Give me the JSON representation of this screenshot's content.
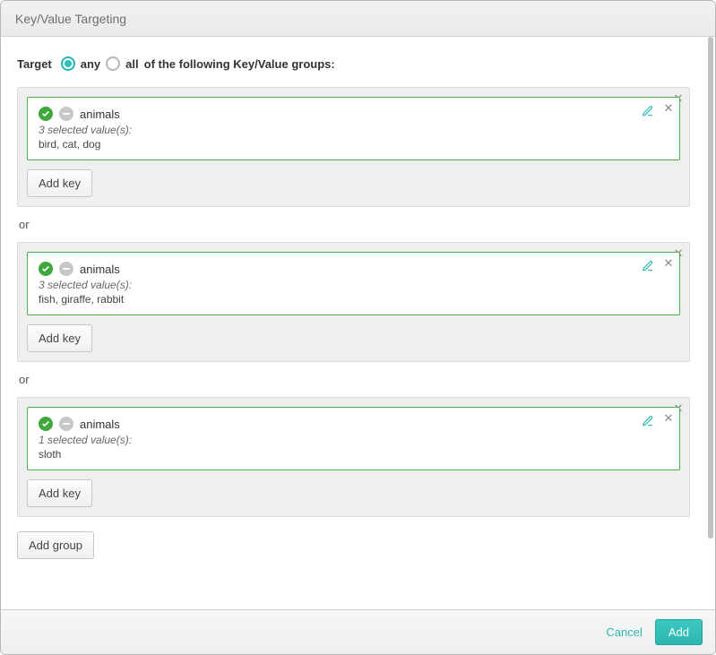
{
  "header": {
    "title": "Key/Value Targeting"
  },
  "target": {
    "label": "Target",
    "any": "any",
    "all": "all",
    "tail": "of the following Key/Value groups:",
    "selected": "any"
  },
  "separator": "or",
  "groups": [
    {
      "key_name": "animals",
      "selected_text": "3 selected value(s):",
      "values": "bird, cat, dog",
      "add_key_label": "Add key"
    },
    {
      "key_name": "animals",
      "selected_text": "3 selected value(s):",
      "values": "fish, giraffe, rabbit",
      "add_key_label": "Add key"
    },
    {
      "key_name": "animals",
      "selected_text": "1 selected value(s):",
      "values": "sloth",
      "add_key_label": "Add key"
    }
  ],
  "add_group_label": "Add group",
  "footer": {
    "cancel": "Cancel",
    "add": "Add"
  },
  "colors": {
    "accent": "#2cb8b0",
    "ok": "#3fa83c",
    "card_border": "#4bb543"
  }
}
